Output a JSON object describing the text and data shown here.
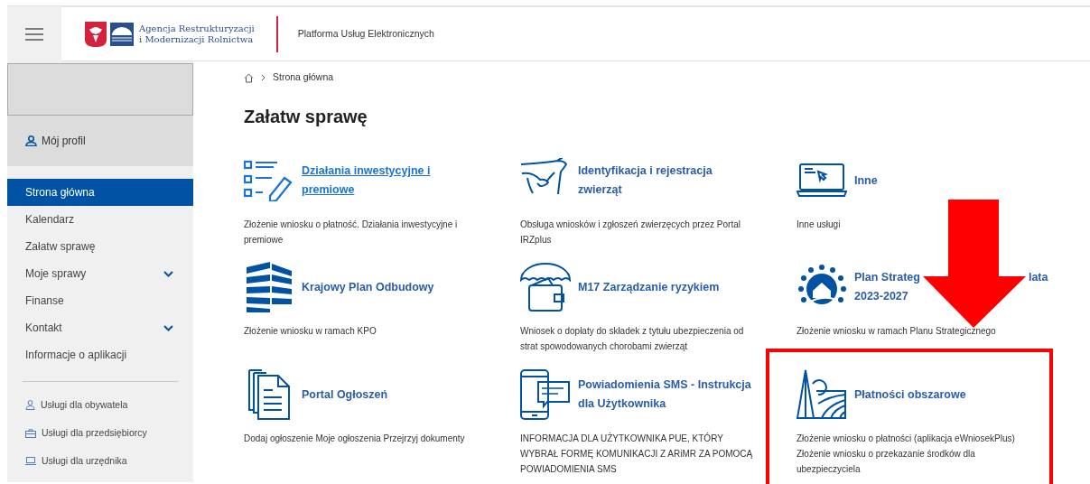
{
  "header": {
    "agency_lines": [
      "Agencja Restrukturyzacji",
      "i Modernizacji Rolnictwa"
    ],
    "platform": "Platforma Usług Elektronicznych"
  },
  "sidebar": {
    "profile": "Mój profil",
    "items": [
      {
        "label": "Strona główna",
        "selected": true,
        "expandable": false
      },
      {
        "label": "Kalendarz",
        "selected": false,
        "expandable": false
      },
      {
        "label": "Załatw sprawę",
        "selected": false,
        "expandable": false
      },
      {
        "label": "Moje sprawy",
        "selected": false,
        "expandable": true
      },
      {
        "label": "Finanse",
        "selected": false,
        "expandable": false
      },
      {
        "label": "Kontakt",
        "selected": false,
        "expandable": true
      },
      {
        "label": "Informacje o aplikacji",
        "selected": false,
        "expandable": false
      }
    ],
    "services": [
      "Usługi dla obywatela",
      "Usługi dla przedsiębiorcy",
      "Usługi dla urzędnika"
    ]
  },
  "breadcrumb": [
    "Strona główna"
  ],
  "title": "Załatw sprawę",
  "cards": [
    {
      "title_lines": [
        [
          "Działania inwestycyjne i"
        ],
        [
          "premiowe"
        ]
      ],
      "hovered": true,
      "description": "Złożenie wniosku o płatność. Działania inwestycyjne i premiowe"
    },
    {
      "title_lines": [
        [
          "Identyfikacja i rejestracja"
        ],
        [
          "zwierząt"
        ]
      ],
      "hovered": false,
      "description": "Obsługa wniosków i zgłoszeń zwierzęcych przez Portal IRZplus"
    },
    {
      "title_lines": [
        [
          "Inne"
        ]
      ],
      "hovered": false,
      "description": "Inne usługi"
    },
    {
      "title_lines": [
        [
          "Krajowy Plan Odbudowy"
        ]
      ],
      "hovered": false,
      "description": "Złożenie wniosku w ramach KPO"
    },
    {
      "title_lines": [
        [
          "M17 Zarządzanie ryzykiem"
        ]
      ],
      "hovered": false,
      "description": "Wniosek o dopłaty do składek z tytułu ubezpieczenia od strat spowodowanych chorobami zwierząt"
    },
    {
      "title_lines": [
        [
          "Plan Strateg",
          "lata"
        ],
        [
          "2023-2027"
        ]
      ],
      "hovered": false,
      "description": "Złożenie wniosku w ramach Planu Strategicznego"
    },
    {
      "title_lines": [
        [
          "Portal Ogłoszeń"
        ]
      ],
      "hovered": false,
      "description": "Dodaj ogłoszenie Moje ogłoszenia Przejrzyj dokumenty"
    },
    {
      "title_lines": [
        [
          "Powiadomienia SMS - Instrukcja"
        ],
        [
          "dla Użytkownika"
        ]
      ],
      "hovered": false,
      "description": "INFORMACJA DLA UŻYTKOWNIKA PUE, KTÓRY WYBRAŁ FORMĘ KOMUNIKACJI Z ARiMR ZA POMOCĄ POWIADOMIENIA SMS"
    },
    {
      "title_lines": [
        [
          "Płatności obszarowe"
        ]
      ],
      "hovered": false,
      "description": "Złożenie wniosku o płatności (aplikacja eWniosekPlus) Złożenie wniosku o przekazanie środków dla ubezpieczyciela"
    }
  ]
}
